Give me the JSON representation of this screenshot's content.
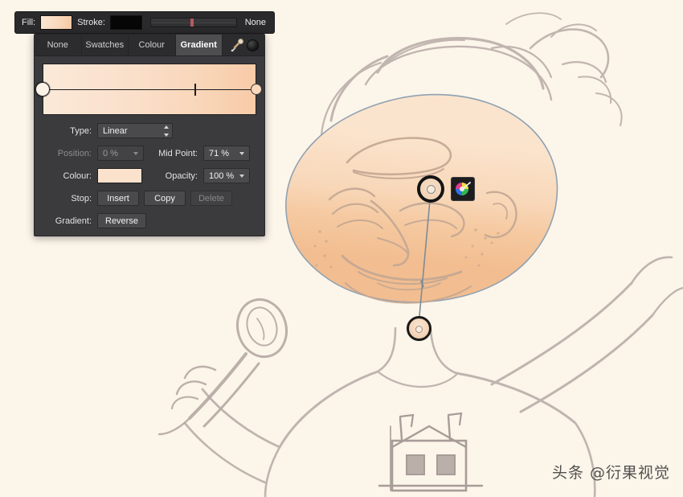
{
  "app": {
    "canvas_bg": "#fcf5ea",
    "panel_bg": "#3b3b3d",
    "accent": "#f8cba8"
  },
  "fill_stroke_bar": {
    "fill_label": "Fill:",
    "fill_color": "#f9d9bd",
    "stroke_label": "Stroke:",
    "stroke_color": "#060606",
    "stroke_none_label": "None"
  },
  "gradient_panel": {
    "tabs": [
      {
        "label": "None",
        "active": false
      },
      {
        "label": "Swatches",
        "active": false
      },
      {
        "label": "Colour",
        "active": false
      },
      {
        "label": "Gradient",
        "active": true
      }
    ],
    "tools": {
      "eyedropper": "eyedropper-icon",
      "color_wheel": "color-wheel-icon"
    },
    "preview": {
      "start_color": "#fbe9d8",
      "end_color": "#f8cba8",
      "mid_point_percent": 71
    },
    "fields": {
      "type_label": "Type:",
      "type_value": "Linear",
      "position_label": "Position:",
      "position_value": "0 %",
      "midpoint_label": "Mid Point:",
      "midpoint_value": "71 %",
      "colour_label": "Colour:",
      "colour_value": "#fae2cc",
      "opacity_label": "Opacity:",
      "opacity_value": "100 %",
      "stop_label": "Stop:",
      "stop_insert": "Insert",
      "stop_copy": "Copy",
      "stop_delete": "Delete",
      "gradient_label": "Gradient:",
      "gradient_reverse": "Reverse"
    }
  },
  "canvas": {
    "color_wheel_button": "color-wheel-picker-button",
    "gradient_start_handle": "gradient-start-handle",
    "gradient_end_handle": "gradient-end-handle"
  },
  "watermark": {
    "text": "头条 @衍果视觉"
  }
}
